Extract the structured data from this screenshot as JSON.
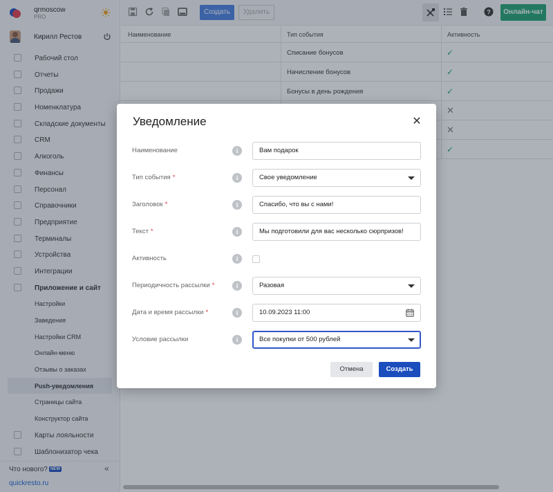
{
  "brand": {
    "name": "qrmoscow",
    "tier": "PRO"
  },
  "user": {
    "name": "Кирилл Рестов"
  },
  "sidebar": {
    "items": [
      {
        "label": "Рабочий стол",
        "icon": "dashboard-icon"
      },
      {
        "label": "Отчеты",
        "icon": "reports-icon"
      },
      {
        "label": "Продажи",
        "icon": "sales-icon"
      },
      {
        "label": "Номенклатура",
        "icon": "nomenclature-icon"
      },
      {
        "label": "Складские документы",
        "icon": "warehouse-icon"
      },
      {
        "label": "CRM",
        "icon": "crm-icon"
      },
      {
        "label": "Алкоголь",
        "icon": "alcohol-icon"
      },
      {
        "label": "Финансы",
        "icon": "finance-icon"
      },
      {
        "label": "Персонал",
        "icon": "staff-icon"
      },
      {
        "label": "Справочники",
        "icon": "reference-icon"
      },
      {
        "label": "Предприятие",
        "icon": "enterprise-icon"
      },
      {
        "label": "Терминалы",
        "icon": "terminal-icon"
      },
      {
        "label": "Устройства",
        "icon": "devices-icon"
      },
      {
        "label": "Интеграции",
        "icon": "integrations-icon"
      },
      {
        "label": "Приложение и сайт",
        "icon": "app-site-icon"
      }
    ],
    "subitems": [
      "Настройки",
      "Заведения",
      "Настройки CRM",
      "Онлайн-меню",
      "Отзывы о заказах",
      "Push-уведомления",
      "Страницы сайта",
      "Конструктор сайта"
    ],
    "items_after": [
      {
        "label": "Карты лояльности",
        "icon": "loyalty-icon"
      },
      {
        "label": "Шаблонизатор чека",
        "icon": "receipt-icon"
      }
    ],
    "news_label": "Что нового?",
    "news_badge": "NEW",
    "footer_link": "quickresto.ru"
  },
  "toolbar": {
    "create_label": "Создать",
    "delete_label": "Удалить",
    "chat_label": "Онлайн-чат"
  },
  "table": {
    "headers": [
      "Наименование",
      "Тип события",
      "Активность"
    ],
    "rows": [
      {
        "name": "",
        "event": "Списание бонусов",
        "active": true
      },
      {
        "name": "",
        "event": "Начисление бонусов",
        "active": true
      },
      {
        "name": "",
        "event": "Бонусы в день рождения",
        "active": true
      },
      {
        "name": "",
        "event": "",
        "active": false
      },
      {
        "name": "",
        "event": "",
        "active": false
      },
      {
        "name": "",
        "event": "",
        "active": true
      }
    ]
  },
  "modal": {
    "title": "Уведомление",
    "fields": {
      "name": {
        "label": "Наименование",
        "value": "Вам подарок"
      },
      "event_type": {
        "label": "Тип события",
        "value": "Свое уведомление"
      },
      "heading": {
        "label": "Заголовок",
        "value": "Спасибо, что вы с нами!"
      },
      "text": {
        "label": "Текст",
        "value": "Мы подготовили для вас несколько сюрпризов!"
      },
      "activity": {
        "label": "Активность",
        "checked": false
      },
      "periodicity": {
        "label": "Периодичность рассылки",
        "value": "Разовая"
      },
      "datetime": {
        "label": "Дата и время рассылки",
        "value": "10.09.2023 11:00"
      },
      "condition": {
        "label": "Условие рассылки",
        "value": "Все покупки от 500 рублей"
      }
    },
    "required_mark": "*",
    "info_glyph": "i",
    "cancel_label": "Отмена",
    "create_label": "Создать"
  },
  "colors": {
    "accent": "#1b4dbd",
    "chat": "#1fa36f",
    "required": "#d9363e"
  }
}
